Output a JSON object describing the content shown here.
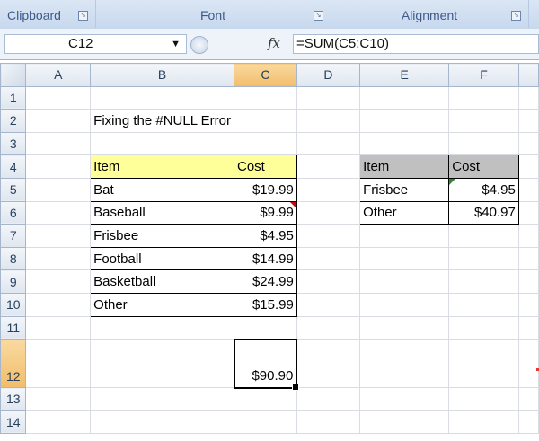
{
  "ribbon": {
    "groups": [
      {
        "label": "Clipboard"
      },
      {
        "label": "Font"
      },
      {
        "label": "Alignment"
      }
    ]
  },
  "formula_bar": {
    "name_box": "C12",
    "fx": "fx",
    "formula": "=SUM(C5:C10)"
  },
  "sheet": {
    "columns": [
      "A",
      "B",
      "C",
      "D",
      "E",
      "F"
    ],
    "rows": [
      "1",
      "2",
      "3",
      "4",
      "5",
      "6",
      "7",
      "8",
      "9",
      "10",
      "11",
      "12",
      "13",
      "14"
    ],
    "selected_cell": "C12",
    "title": "Fixing the #NULL Error",
    "table1": {
      "header": {
        "item": "Item",
        "cost": "Cost"
      },
      "rows": [
        {
          "item": "Bat",
          "cost": "$19.99"
        },
        {
          "item": "Baseball",
          "cost": "$9.99"
        },
        {
          "item": "Frisbee",
          "cost": "$4.95"
        },
        {
          "item": "Football",
          "cost": "$14.99"
        },
        {
          "item": "Basketball",
          "cost": "$24.99"
        },
        {
          "item": "Other",
          "cost": "$15.99"
        }
      ]
    },
    "table2": {
      "header": {
        "item": "Item",
        "cost": "Cost"
      },
      "rows": [
        {
          "item": "Frisbee",
          "cost": "$4.95"
        },
        {
          "item": "Other",
          "cost": "$40.97"
        }
      ]
    },
    "total": "$90.90"
  },
  "colors": {
    "header_fill_table1": "#ffff99",
    "header_fill_table2": "#c0c0c0",
    "selection_header": "#f2bd6a"
  }
}
